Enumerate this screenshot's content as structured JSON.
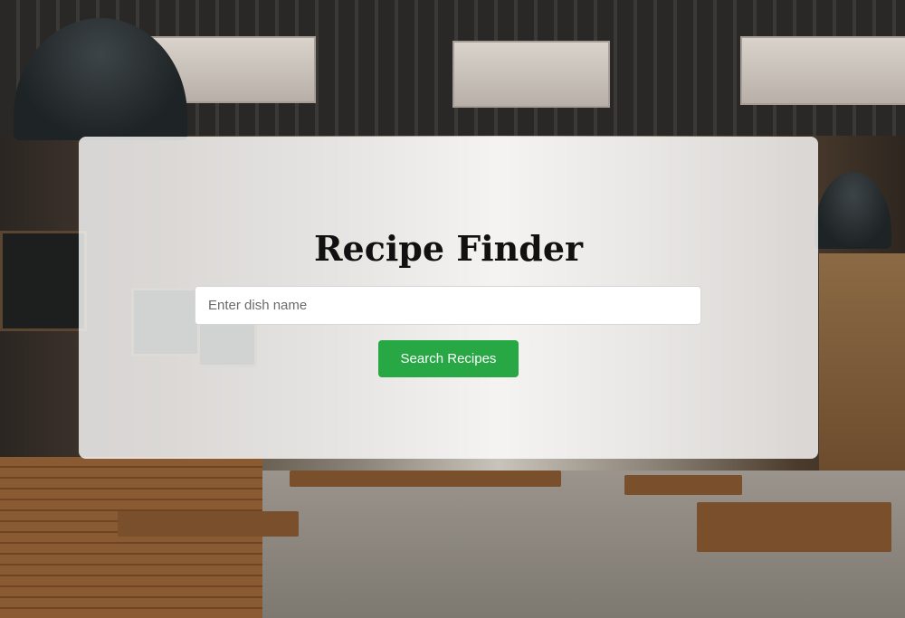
{
  "page": {
    "title": "Recipe Finder"
  },
  "search": {
    "placeholder": "Enter dish name",
    "value": "",
    "button_label": "Search Recipes"
  },
  "colors": {
    "button_bg": "#28a745",
    "button_text": "#ffffff",
    "card_bg": "rgba(255,255,255,0.80)",
    "title_text": "#111111"
  },
  "background": {
    "description_icon": "cafe-photo"
  }
}
